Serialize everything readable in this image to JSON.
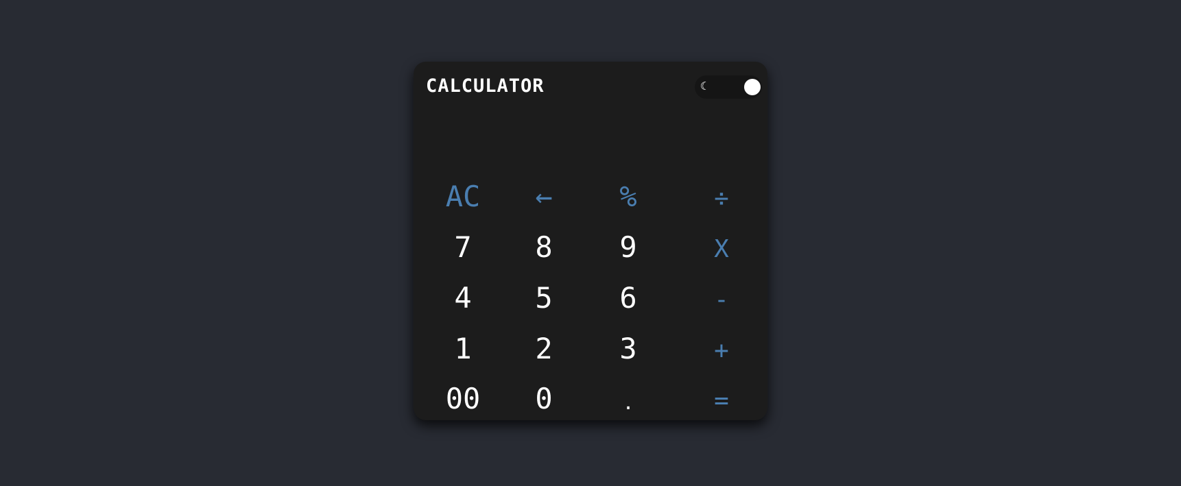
{
  "app": {
    "title": "CALCULATOR"
  },
  "theme_toggle": {
    "icon": "moon-icon",
    "state": "dark"
  },
  "display": {
    "value": ""
  },
  "keys": {
    "clear": "AC",
    "backspace": "←",
    "percent": "%",
    "divide": "÷",
    "seven": "7",
    "eight": "8",
    "nine": "9",
    "multiply": "X",
    "four": "4",
    "five": "5",
    "six": "6",
    "subtract": "-",
    "one": "1",
    "two": "2",
    "three": "3",
    "add": "+",
    "double_zero": "00",
    "zero": "0",
    "decimal": ".",
    "equals": "="
  },
  "colors": {
    "page_background": "#282b33",
    "calculator_background": "#1c1c1c",
    "accent": "#4a7eb0",
    "digit": "#ffffff"
  }
}
